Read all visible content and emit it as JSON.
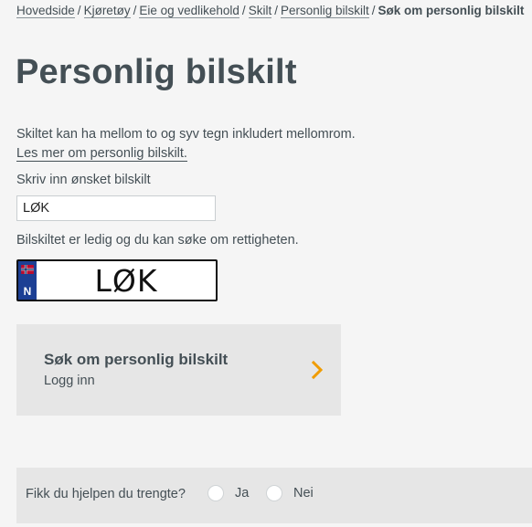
{
  "breadcrumb": {
    "items": [
      "Hovedside",
      "Kjøretøy",
      "Eie og vedlikehold",
      "Skilt",
      "Personlig bilskilt"
    ],
    "current": "Søk om personlig bilskilt",
    "separator": "/"
  },
  "page": {
    "title": "Personlig bilskilt",
    "intro": "Skiltet kan ha mellom to og syv tegn inkludert mellomrom.",
    "read_more_link": "Les mer om personlig bilskilt."
  },
  "plate_form": {
    "label": "Skriv inn ønsket bilskilt",
    "value": "LØK",
    "status": "Bilskiltet er ledig og du kan søke om rettigheten."
  },
  "plate_preview": {
    "characters": "LØK",
    "country_code": "N",
    "band_color": "#1c3f94",
    "flag_icon": "norway-flag-icon"
  },
  "apply_card": {
    "title": "Søk om personlig bilskilt",
    "subtitle": "Logg inn",
    "arrow_icon": "chevron-right-icon",
    "arrow_color": "#f09c00"
  },
  "feedback": {
    "question": "Fikk du hjelpen du trengte?",
    "options": [
      "Ja",
      "Nei"
    ]
  }
}
